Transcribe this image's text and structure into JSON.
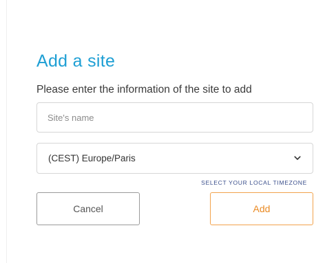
{
  "dialog": {
    "title": "Add a site",
    "subtitle": "Please enter the information of the site to add",
    "site_name": {
      "value": "",
      "placeholder": "Site's name"
    },
    "timezone": {
      "selected": "(CEST) Europe/Paris",
      "icon": "chevron-down-icon"
    },
    "timezone_link": "SELECT YOUR LOCAL TIMEZONE",
    "cancel_label": "Cancel",
    "add_label": "Add"
  },
  "colors": {
    "title": "#1e9fd4",
    "link": "#3b4f8c",
    "add_accent": "#ea8a23",
    "add_border": "#f2a24b",
    "border": "#d6d6d6"
  }
}
